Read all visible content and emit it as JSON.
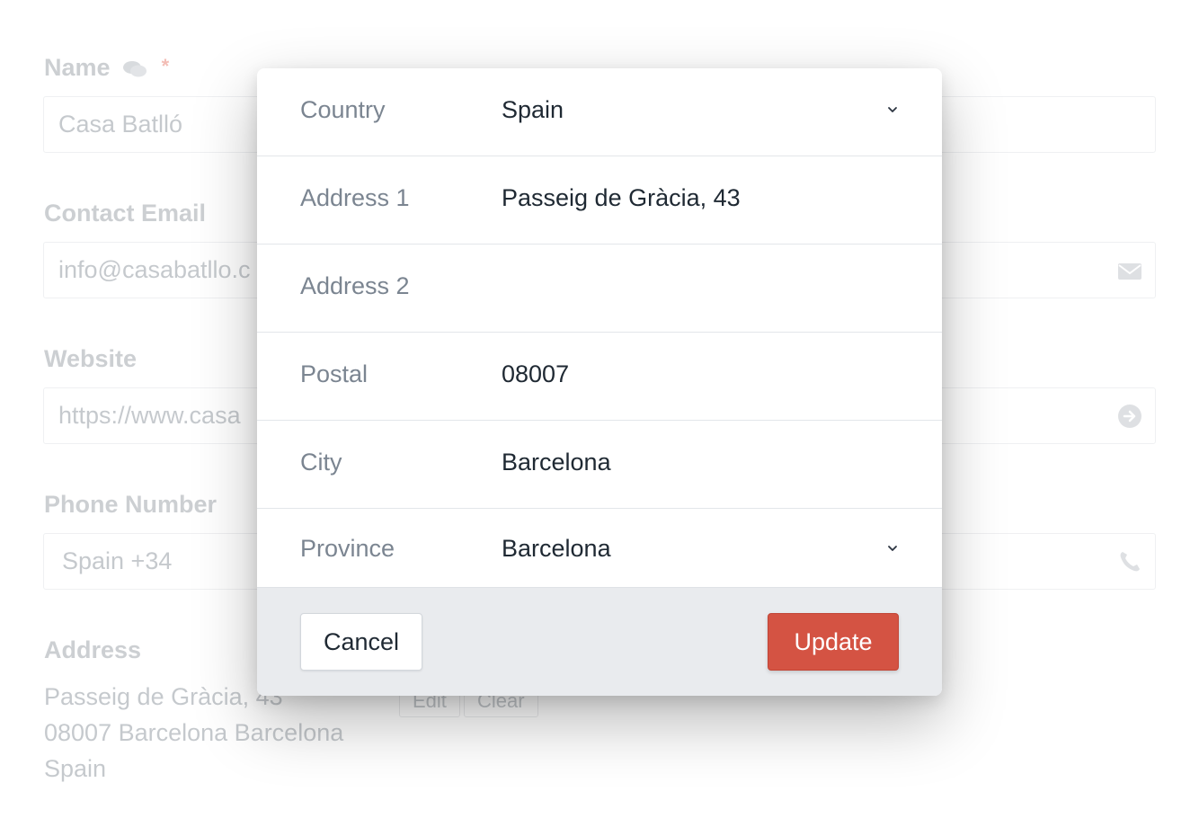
{
  "background_form": {
    "name": {
      "label": "Name",
      "value": "Casa Batlló",
      "required_mark": "*"
    },
    "contact_email": {
      "label": "Contact Email",
      "value": "info@casabatllo.c"
    },
    "website": {
      "label": "Website",
      "value": "https://www.casa"
    },
    "phone": {
      "label": "Phone Number",
      "value": "Spain +34"
    },
    "address": {
      "label": "Address",
      "lines": [
        "Passeig de Gràcia, 43",
        "08007 Barcelona Barcelona",
        "Spain"
      ],
      "edit_label": "Edit",
      "clear_label": "Clear"
    }
  },
  "modal": {
    "fields": [
      {
        "label": "Country",
        "value": "Spain",
        "type": "select"
      },
      {
        "label": "Address 1",
        "value": "Passeig de Gràcia, 43",
        "type": "text"
      },
      {
        "label": "Address 2",
        "value": "",
        "type": "text"
      },
      {
        "label": "Postal",
        "value": "08007",
        "type": "text"
      },
      {
        "label": "City",
        "value": "Barcelona",
        "type": "text"
      },
      {
        "label": "Province",
        "value": "Barcelona",
        "type": "select"
      }
    ],
    "cancel_label": "Cancel",
    "update_label": "Update"
  },
  "colors": {
    "accent": "#d45343",
    "footer_bg": "#e9ebee",
    "label_text": "#7b8591",
    "value_text": "#1f2933"
  }
}
